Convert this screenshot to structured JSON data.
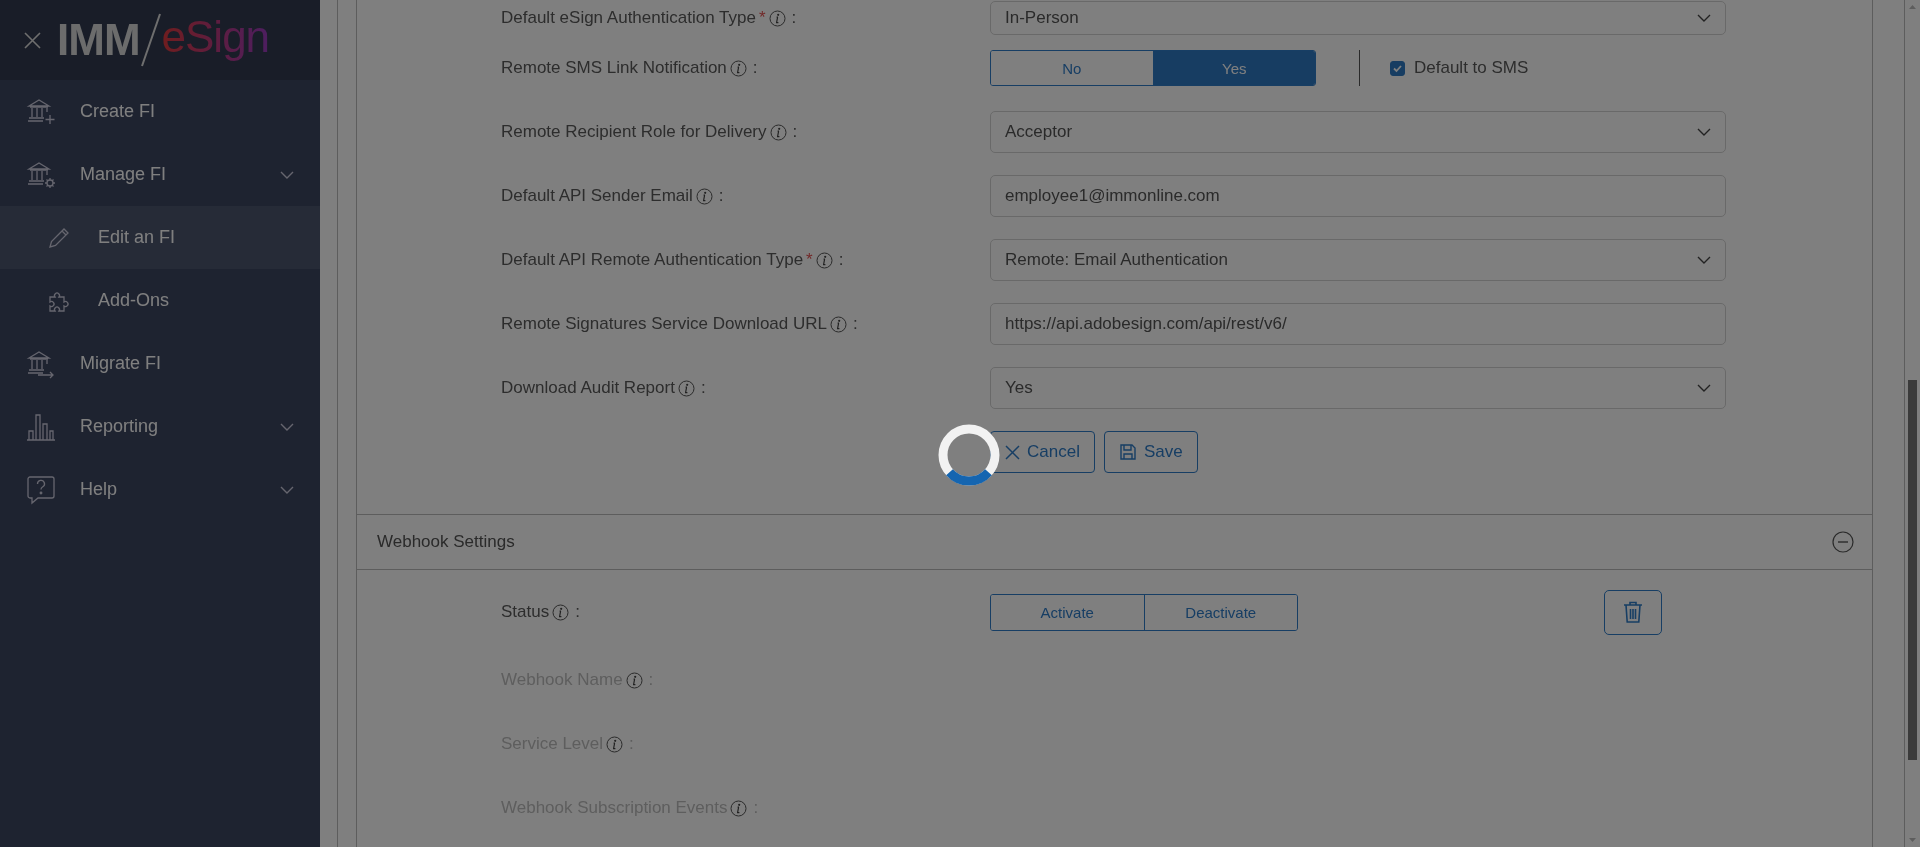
{
  "loading": true,
  "sidebar": {
    "logo": {
      "left": "IMM",
      "right": "eSign"
    },
    "items": [
      {
        "label": "Create FI",
        "selected": false,
        "collapsible": false
      },
      {
        "label": "Manage FI",
        "selected": false,
        "collapsible": true,
        "children": [
          {
            "label": "Edit an FI",
            "selected": true
          },
          {
            "label": "Add-Ons",
            "selected": false
          }
        ]
      },
      {
        "label": "Migrate FI",
        "selected": false,
        "collapsible": false
      },
      {
        "label": "Reporting",
        "selected": false,
        "collapsible": true
      },
      {
        "label": "Help",
        "selected": false,
        "collapsible": true
      }
    ]
  },
  "settings": {
    "rows": [
      {
        "label": "Default eSign Authentication Type",
        "required": "*",
        "separator": ":",
        "kind": "select",
        "value": "In-Person"
      },
      {
        "label": "Remote SMS Link Notification",
        "separator": ":",
        "kind": "toggle",
        "options": [
          {
            "label": "No",
            "selected": false
          },
          {
            "label": "Yes",
            "selected": true
          }
        ],
        "checkbox": {
          "label": "Default to SMS",
          "checked": true
        }
      },
      {
        "label": "Remote Recipient Role for Delivery",
        "separator": ":",
        "kind": "select",
        "value": "Acceptor"
      },
      {
        "label": "Default API Sender Email",
        "separator": ":",
        "kind": "text",
        "value": "employee1@immonline.com"
      },
      {
        "label": "Default API Remote Authentication Type",
        "required": "*",
        "separator": ":",
        "kind": "select",
        "value": "Remote: Email Authentication"
      },
      {
        "label": "Remote Signatures Service Download URL",
        "separator": ":",
        "kind": "text",
        "value": "https://api.adobesign.com/api/rest/v6/"
      },
      {
        "label": "Download Audit Report",
        "separator": ":",
        "kind": "select",
        "value": "Yes"
      }
    ],
    "buttons": [
      {
        "label": "Cancel",
        "kind": "cancel"
      },
      {
        "label": "Save",
        "kind": "save"
      }
    ]
  },
  "webhook": {
    "title": "Webhook Settings",
    "rows": [
      {
        "label": "Status",
        "separator": ":",
        "disabled": false,
        "kind": "toggle",
        "options": [
          {
            "label": "Activate",
            "selected": false
          },
          {
            "label": "Deactivate",
            "selected": false
          }
        ]
      },
      {
        "label": "Webhook Name",
        "separator": ":",
        "disabled": true,
        "kind": "empty"
      },
      {
        "label": "Service Level",
        "separator": ":",
        "disabled": true,
        "kind": "empty"
      },
      {
        "label": "Webhook Subscription Events",
        "separator": ":",
        "disabled": true,
        "kind": "empty"
      }
    ]
  }
}
